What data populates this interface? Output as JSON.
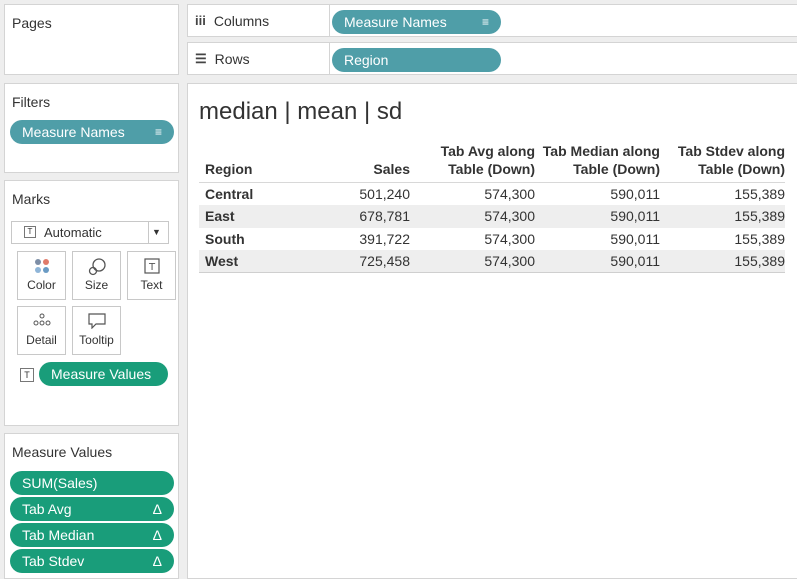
{
  "pages": {
    "title": "Pages"
  },
  "columns": {
    "label": "Columns",
    "icon": "iii",
    "pill": "Measure Names"
  },
  "rows": {
    "label": "Rows",
    "icon": "☰",
    "pill": "Region"
  },
  "filters": {
    "title": "Filters",
    "pill": "Measure Names"
  },
  "marks": {
    "title": "Marks",
    "type": "Automatic",
    "buttons": [
      {
        "label": "Color"
      },
      {
        "label": "Size"
      },
      {
        "label": "Text"
      },
      {
        "label": "Detail"
      },
      {
        "label": "Tooltip"
      }
    ],
    "text_pill": "Measure Values"
  },
  "measure_values": {
    "title": "Measure Values",
    "pills": [
      "SUM(Sales)",
      "Tab Avg",
      "Tab Median",
      "Tab Stdev"
    ],
    "delta": "Δ"
  },
  "view": {
    "title": "median | mean | sd",
    "headers": {
      "region": "Region",
      "sales": "Sales",
      "avg": [
        "Tab Avg along",
        "Table (Down)"
      ],
      "median": [
        "Tab Median along",
        "Table (Down)"
      ],
      "stdev": [
        "Tab Stdev along",
        "Table (Down)"
      ]
    },
    "rows": [
      {
        "region": "Central",
        "sales": "501,240",
        "avg": "574,300",
        "median": "590,011",
        "stdev": "155,389"
      },
      {
        "region": "East",
        "sales": "678,781",
        "avg": "574,300",
        "median": "590,011",
        "stdev": "155,389"
      },
      {
        "region": "South",
        "sales": "391,722",
        "avg": "574,300",
        "median": "590,011",
        "stdev": "155,389"
      },
      {
        "region": "West",
        "sales": "725,458",
        "avg": "574,300",
        "median": "590,011",
        "stdev": "155,389"
      }
    ]
  },
  "colors": {
    "dimension_pill": "#4f9ea8",
    "measure_pill": "#199d7a"
  }
}
